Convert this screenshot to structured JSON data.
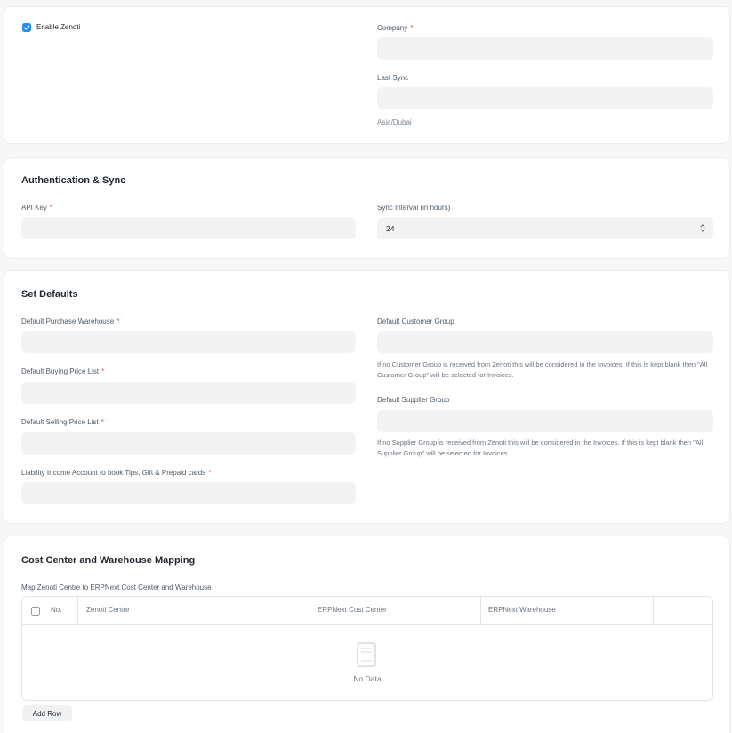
{
  "settings": {
    "enable_label": "Enable Zenoti",
    "enabled": true,
    "company_label": "Company",
    "company_value": "",
    "last_sync_label": "Last Sync",
    "last_sync_value": "",
    "timezone": "Asia/Dubai"
  },
  "auth": {
    "title": "Authentication & Sync",
    "api_key_label": "API Key",
    "api_key_value": "",
    "sync_interval_label": "Sync Interval (in hours)",
    "sync_interval_value": "24"
  },
  "defaults": {
    "title": "Set Defaults",
    "purchase_warehouse_label": "Default Purchase Warehouse",
    "buying_price_list_label": "Default Buying Price List",
    "selling_price_list_label": "Default Selling Price List",
    "liability_account_label": "Liability Income Account to book Tips, Gift & Prepaid cards",
    "customer_group_label": "Default Customer Group",
    "customer_group_desc": "If no Customer Group is received from Zenoti this will be considered in the Invoices. If this is kept blank then \"All Customer Group\" will be selected for Invoices.",
    "supplier_group_label": "Default Supplier Group",
    "supplier_group_desc": "If no Supplier Group is received from Zenoti this will be considered in the Invoices. If this is kept blank then \"All Supplier Group\" will be selected for Invoices."
  },
  "mapping": {
    "title": "Cost Center and Warehouse Mapping",
    "table_label": "Map Zenoti Centre to ERPNext Cost Center and Warehouse",
    "columns": [
      "No.",
      "Zenoti Centre",
      "ERPNext Cost Center",
      "ERPNext Warehouse"
    ],
    "empty_text": "No Data",
    "add_row_label": "Add Row"
  },
  "required_marker": "*",
  "colors": {
    "accent": "#2490ef",
    "required": "#e24c4c",
    "input_bg": "#f3f3f3"
  }
}
